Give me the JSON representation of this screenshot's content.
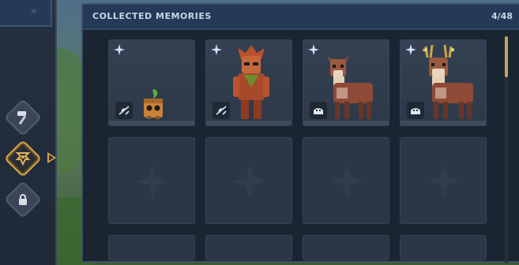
{
  "panel": {
    "title": "COLLECTED MEMORIES",
    "count": "4/48"
  },
  "rail": {
    "buttons": [
      {
        "name": "hammer-icon",
        "active": false
      },
      {
        "name": "memories-icon",
        "active": true
      },
      {
        "name": "lock-icon",
        "active": false
      }
    ]
  },
  "memories": [
    {
      "name": "sapling-creature",
      "badge_icon": "plant-icon",
      "collected": true
    },
    {
      "name": "leafy-humanoid",
      "badge_icon": "plant-icon",
      "collected": true
    },
    {
      "name": "deer-doe",
      "badge_icon": "animal-icon",
      "collected": true
    },
    {
      "name": "antlered-stag",
      "badge_icon": "animal-icon",
      "collected": true
    }
  ],
  "colors": {
    "accent": "#d9a947",
    "panel_header": "#243a57",
    "slot": "#2b3746",
    "text": "#c9d6e6"
  }
}
